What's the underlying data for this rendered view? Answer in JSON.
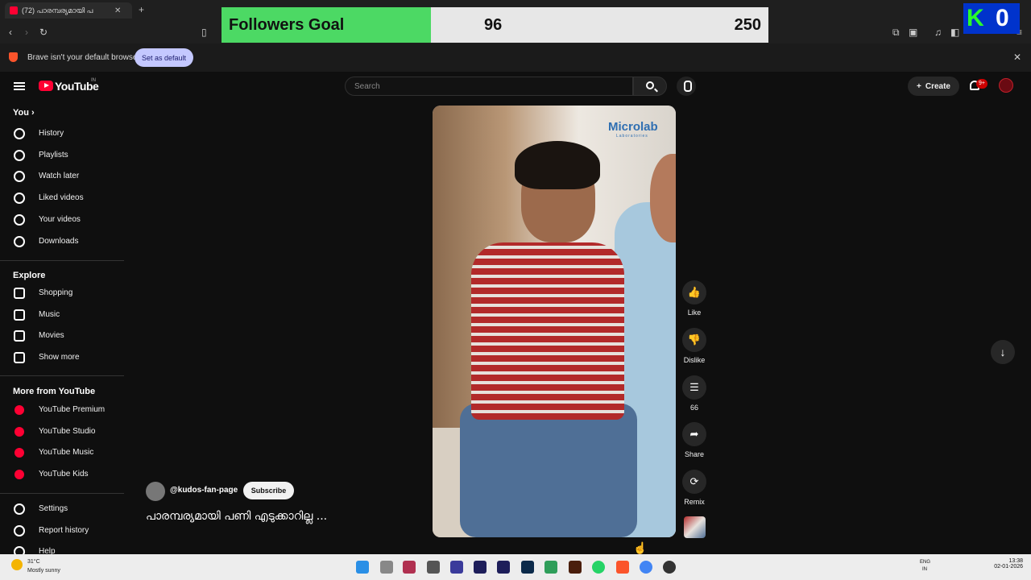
{
  "browser": {
    "tab_title": "(72) പാരമ്പര്യമായി പ",
    "tab_close": "✕",
    "new_tab": "+",
    "infobar_message": "Brave isn't your default browser",
    "set_default_label": "Set as default",
    "infobar_close": "✕"
  },
  "overlay": {
    "goal_label": "Followers Goal",
    "current": 96,
    "target": 250,
    "current_text": "96",
    "target_text": "250",
    "bar_fill_color": "#4cd964",
    "badge_k": "K",
    "badge_count": "0"
  },
  "header": {
    "logo_text": "YouTube",
    "country_code": "IN",
    "search_placeholder": "Search",
    "create_label": "Create",
    "notification_badge": "9+"
  },
  "sidebar": {
    "you_label": "You",
    "you_items": [
      {
        "label": "History",
        "icon": "history-icon"
      },
      {
        "label": "Playlists",
        "icon": "playlist-icon"
      },
      {
        "label": "Watch later",
        "icon": "clock-icon"
      },
      {
        "label": "Liked videos",
        "icon": "thumbs-up-icon"
      },
      {
        "label": "Your videos",
        "icon": "video-icon"
      },
      {
        "label": "Downloads",
        "icon": "download-icon"
      }
    ],
    "explore_label": "Explore",
    "explore_items": [
      {
        "label": "Shopping",
        "icon": "shopping-bag-icon"
      },
      {
        "label": "Music",
        "icon": "music-note-icon"
      },
      {
        "label": "Movies",
        "icon": "film-icon"
      },
      {
        "label": "Show more",
        "icon": "chevron-down-icon"
      }
    ],
    "more_label": "More from YouTube",
    "more_items": [
      {
        "label": "YouTube Premium",
        "icon": "youtube-premium-icon"
      },
      {
        "label": "YouTube Studio",
        "icon": "youtube-studio-icon"
      },
      {
        "label": "YouTube Music",
        "icon": "youtube-music-icon"
      },
      {
        "label": "YouTube Kids",
        "icon": "youtube-kids-icon"
      }
    ],
    "bottom_items": [
      {
        "label": "Settings",
        "icon": "gear-icon"
      },
      {
        "label": "Report history",
        "icon": "flag-icon"
      },
      {
        "label": "Help",
        "icon": "help-icon"
      }
    ]
  },
  "short": {
    "watermark": "Microlab",
    "watermark_sub": "Laboratories",
    "channel": "@kudos-fan-page",
    "subscribe_label": "Subscribe",
    "title": "പാരമ്പര്യമായി പണി എടുക്കാറില്ല ..."
  },
  "actions": [
    {
      "label": "Like",
      "icon": "thumbs-up-icon",
      "glyph": "👍"
    },
    {
      "label": "Dislike",
      "icon": "thumbs-down-icon",
      "glyph": "👎"
    },
    {
      "label": "66",
      "icon": "comment-icon",
      "glyph": "☰"
    },
    {
      "label": "Share",
      "icon": "share-icon",
      "glyph": "➦"
    },
    {
      "label": "Remix",
      "icon": "remix-icon",
      "glyph": "⟳"
    }
  ],
  "taskbar": {
    "temperature": "31°C",
    "weather": "Mostly sunny",
    "lang": "ENG",
    "region": "IN",
    "time": "13:38",
    "date": "02-01-2026"
  }
}
